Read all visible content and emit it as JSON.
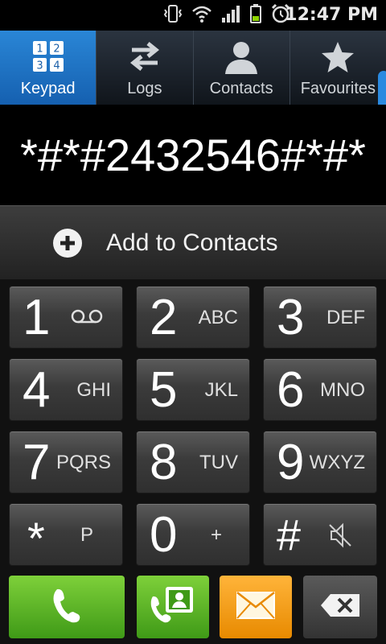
{
  "status": {
    "time": "12:47 PM",
    "icons": [
      "vibrate-icon",
      "wifi-icon",
      "signal-icon",
      "battery-icon",
      "alarm-icon"
    ]
  },
  "tabs": [
    {
      "label": "Keypad",
      "icon": "keypad-icon",
      "active": true
    },
    {
      "label": "Logs",
      "icon": "logs-icon",
      "active": false
    },
    {
      "label": "Contacts",
      "icon": "contacts-icon",
      "active": false
    },
    {
      "label": "Favourites",
      "icon": "star-icon",
      "active": false
    }
  ],
  "display": {
    "number": "*#*#2432546#*#*"
  },
  "add_contact": {
    "label": "Add to Contacts"
  },
  "keypad": {
    "keys": [
      {
        "digit": "1",
        "letters": ""
      },
      {
        "digit": "2",
        "letters": "ABC"
      },
      {
        "digit": "3",
        "letters": "DEF"
      },
      {
        "digit": "4",
        "letters": "GHI"
      },
      {
        "digit": "5",
        "letters": "JKL"
      },
      {
        "digit": "6",
        "letters": "MNO"
      },
      {
        "digit": "7",
        "letters": "PQRS"
      },
      {
        "digit": "8",
        "letters": "TUV"
      },
      {
        "digit": "9",
        "letters": "WXYZ"
      },
      {
        "digit": "*",
        "letters": "P"
      },
      {
        "digit": "0",
        "letters": "+"
      },
      {
        "digit": "#",
        "letters": ""
      }
    ],
    "icon_names": {
      "key1": "voicemail-icon",
      "hash": "mute-icon"
    }
  },
  "actions": {
    "call": "call-icon",
    "video_call": "video-call-icon",
    "message": "message-icon",
    "delete": "backspace-icon"
  },
  "colors": {
    "active_tab": "#1f78c8",
    "call_green": "#5cb82a",
    "message_orange": "#f5a000"
  }
}
